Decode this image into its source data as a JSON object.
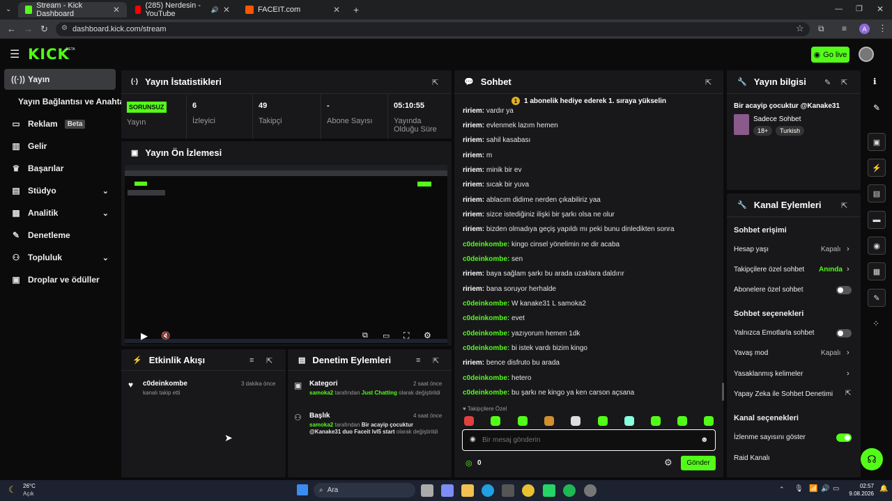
{
  "browser": {
    "tabs": [
      {
        "title": "Stream - Kick Dashboard",
        "active": true
      },
      {
        "title": "(285) Nerdesin - YouTube",
        "active": false
      },
      {
        "title": "FACEIT.com",
        "active": false
      }
    ],
    "url": "dashboard.kick.com/stream",
    "profile_letter": "A"
  },
  "header": {
    "logo": "KICK",
    "logo_sup": "BETA",
    "go_live": "Go live"
  },
  "sidebar": {
    "items": [
      {
        "label": "Yayın"
      },
      {
        "label": "Yayın Bağlantısı ve Anahtarı"
      },
      {
        "label": "Reklam",
        "badge": "Beta"
      },
      {
        "label": "Gelir"
      },
      {
        "label": "Başarılar"
      },
      {
        "label": "Stüdyo"
      },
      {
        "label": "Analitik"
      },
      {
        "label": "Denetleme"
      },
      {
        "label": "Topluluk"
      },
      {
        "label": "Droplar ve ödüller"
      }
    ]
  },
  "stats": {
    "title": "Yayın İstatistikleri",
    "status_badge": "SORUNSUZ",
    "status_label": "Yayın",
    "viewers_value": "6",
    "viewers_label": "İzleyici",
    "followers_value": "49",
    "followers_label": "Takipçi",
    "subs_value": "-",
    "subs_label": "Abone Sayısı",
    "uptime_value": "05:10:55",
    "uptime_label": "Yayında Olduğu Süre"
  },
  "preview": {
    "title": "Yayın Ön İzlemesi"
  },
  "activity": {
    "title": "Etkinlik Akışı",
    "items": [
      {
        "user": "c0deinkombe",
        "text": "kanalı takip etti",
        "time": "3 dakika önce"
      }
    ]
  },
  "moderation": {
    "title": "Denetim Eylemleri",
    "items": [
      {
        "title": "Kategori",
        "time": "2 saat önce",
        "actor": "samoka2",
        "mid": "tarafından",
        "value": "Just Chatting",
        "tail": "olarak değiştirildi"
      },
      {
        "title": "Başlık",
        "time": "4 saat önce",
        "actor": "samoka2",
        "mid": "tarafından",
        "value": "Bir acayip çocuktur @Kanake31 duo Faceit lvl5 start",
        "tail": "olarak değiştirildi"
      }
    ]
  },
  "chat": {
    "title": "Sohbet",
    "pinned": "1 abonelik hediye ederek 1. sıraya yükselin",
    "pinned_rank": "1",
    "messages": [
      {
        "user": "ririem",
        "text": "vardır ya"
      },
      {
        "user": "ririem",
        "text": "evlenmek lazım hemen"
      },
      {
        "user": "ririem",
        "text": "sahil kasabası"
      },
      {
        "user": "ririem",
        "text": "m"
      },
      {
        "user": "ririem",
        "text": "minik bir ev"
      },
      {
        "user": "ririem",
        "text": "sıcak bir yuva"
      },
      {
        "user": "ririem",
        "text": "ablacım didime nerden çıkabiliriz yaa"
      },
      {
        "user": "ririem",
        "text": "sizce istediğiniz ilişki bir şarkı olsa ne olur"
      },
      {
        "user": "ririem",
        "text": "bizden olmadıya geçiş yapıldı mı peki bunu dinledikten sonra"
      },
      {
        "user": "c0deinkombe",
        "text": "kingo cinsel yönelimin ne dir acaba"
      },
      {
        "user": "c0deinkombe",
        "text": "sen"
      },
      {
        "user": "ririem",
        "text": "baya sağlam şarkı bu arada uzaklara daldırır"
      },
      {
        "user": "ririem",
        "text": "bana soruyor herhalde"
      },
      {
        "user": "c0deinkombe",
        "text": "W kanake31 L samoka2"
      },
      {
        "user": "c0deinkombe",
        "text": "evet"
      },
      {
        "user": "c0deinkombe",
        "text": "yazıyorum hemen 1dk"
      },
      {
        "user": "c0deinkombe",
        "text": "bi istek vardı bizim kingo"
      },
      {
        "user": "ririem",
        "text": "bence disfruto bu arada"
      },
      {
        "user": "c0deinkombe",
        "text": "hetero"
      },
      {
        "user": "c0deinkombe",
        "text": "bu şarkı ne kingo ya ken carson açsana"
      }
    ],
    "followers_only": "Takipçilere Özel",
    "input_placeholder": "Bir mesaj gönderin",
    "points": "0",
    "send": "Gönder"
  },
  "stream_info": {
    "title": "Yayın bilgisi",
    "stream_title": "Bir acayip çocuktur @Kanake31",
    "category": "Sadece Sohbet",
    "tags": [
      "18+",
      "Turkish"
    ]
  },
  "channel_actions": {
    "title": "Kanal Eylemleri",
    "chat_access": "Sohbet erişimi",
    "account_age": "Hesap yaşı",
    "account_age_value": "Kapalı",
    "followers_chat": "Takipçilere özel sohbet",
    "followers_chat_value": "Anında",
    "subs_chat": "Abonelere özel sohbet",
    "chat_options": "Sohbet seçenekleri",
    "emote_only": "Yalnızca Emotlarla sohbet",
    "slow_mode": "Yavaş mod",
    "slow_mode_value": "Kapalı",
    "banned_words": "Yasaklanmış kelimeler",
    "ai_mod": "Yapay Zeka ile Sohbet Denetimi",
    "channel_options": "Kanal seçenekleri",
    "show_viewers": "İzlenme sayısını göster",
    "raid": "Raid Kanalı"
  },
  "taskbar": {
    "weather_temp": "26°C",
    "weather_desc": "Açık",
    "search": "Ara",
    "time": "02:57",
    "date": "9.08.2026"
  }
}
